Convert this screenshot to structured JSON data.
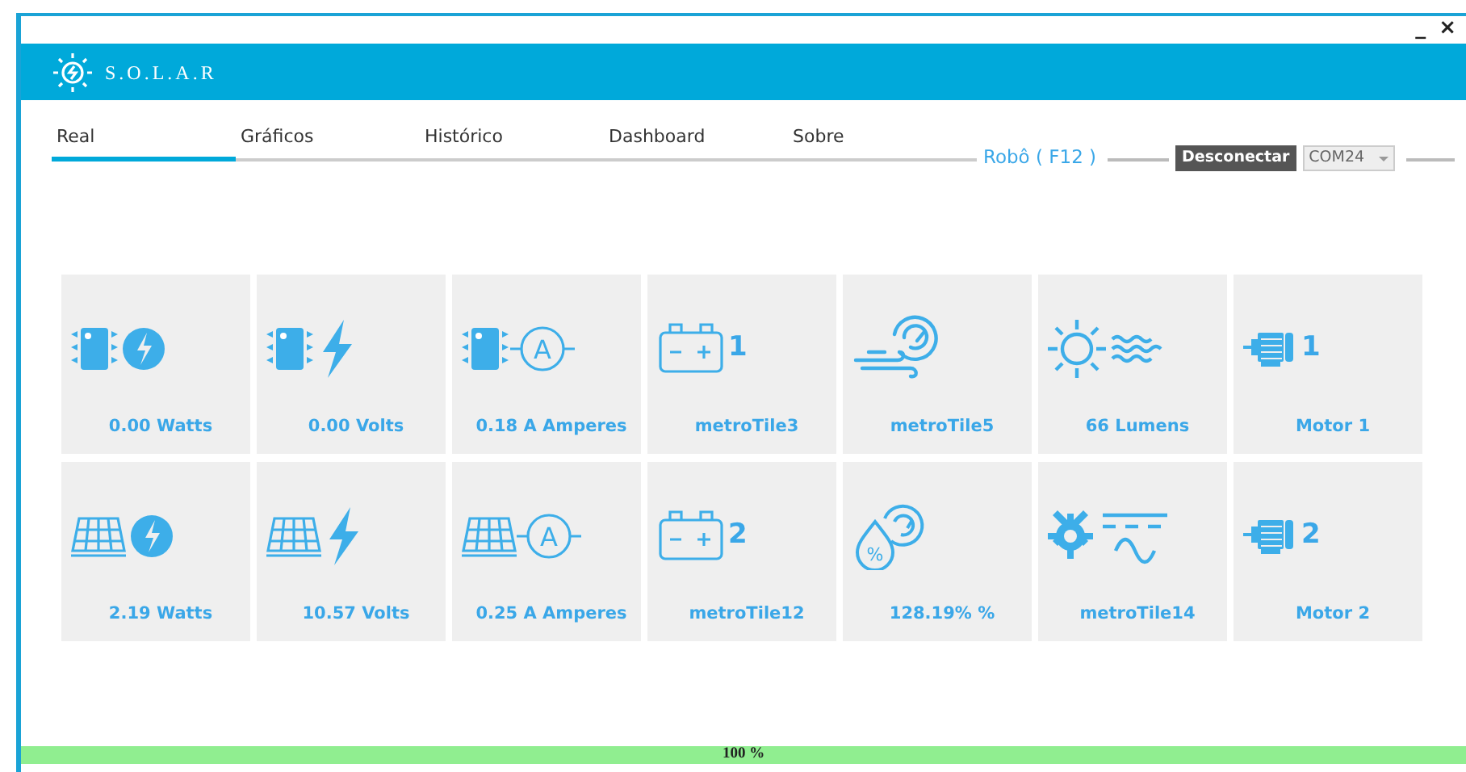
{
  "window": {
    "controls": [
      "_",
      "×"
    ]
  },
  "header": {
    "title": "S.O.L.A.R"
  },
  "tabs": [
    {
      "label": "Real",
      "selected": true
    },
    {
      "label": "Gráficos",
      "selected": false
    },
    {
      "label": "Histórico",
      "selected": false
    },
    {
      "label": "Dashboard",
      "selected": false
    },
    {
      "label": "Sobre",
      "selected": false
    }
  ],
  "connection": {
    "robot": "Robô ( F12 )",
    "button": "Desconectar",
    "port": "COM24"
  },
  "tiles": [
    {
      "kind": "chip-power",
      "label": "0.00 Watts"
    },
    {
      "kind": "chip-bolt",
      "label": "0.00 Volts"
    },
    {
      "kind": "chip-ammeter",
      "symbol": "A",
      "label": "0.18 A Amperes"
    },
    {
      "kind": "battery",
      "index": "1",
      "label": "metroTile3"
    },
    {
      "kind": "wind-gauge",
      "label": "metroTile5"
    },
    {
      "kind": "sun-waves",
      "label": "66 Lumens"
    },
    {
      "kind": "motor",
      "index": "1",
      "label": "Motor 1"
    },
    {
      "kind": "panel-power",
      "label": "2.19 Watts"
    },
    {
      "kind": "panel-bolt",
      "label": "10.57 Volts"
    },
    {
      "kind": "panel-ammeter",
      "symbol": "A",
      "label": "0.25 A Amperes"
    },
    {
      "kind": "battery",
      "index": "2",
      "label": "metroTile12"
    },
    {
      "kind": "drop-gauge",
      "symbol": "%",
      "label": "128.19% %"
    },
    {
      "kind": "gear-signal",
      "label": "metroTile14"
    },
    {
      "kind": "motor",
      "index": "2",
      "label": "Motor 2"
    }
  ],
  "progress": {
    "level": 1.0,
    "text": "100 %"
  }
}
